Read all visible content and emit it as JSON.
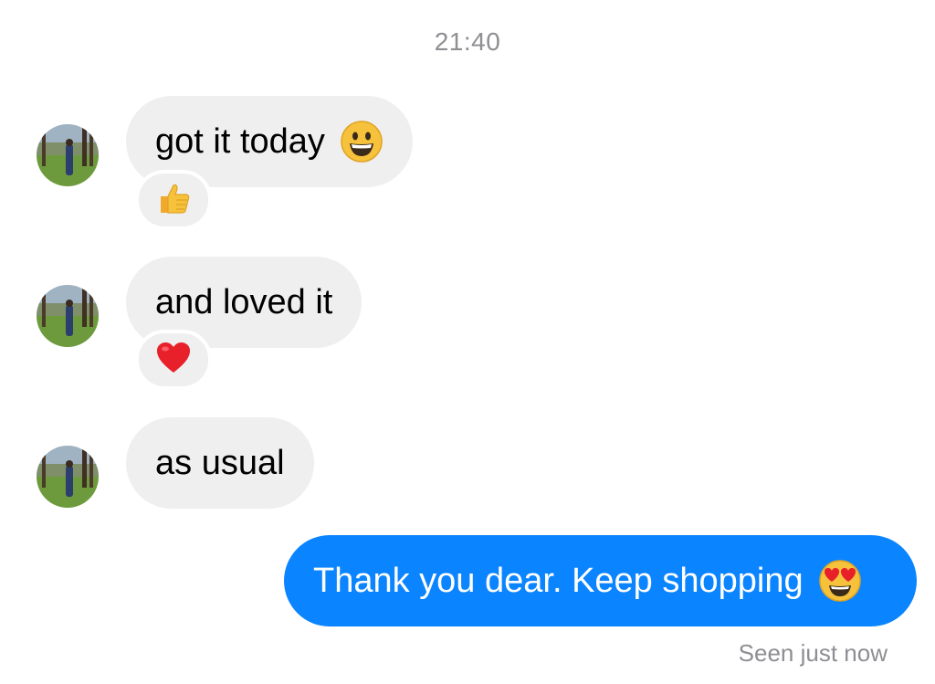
{
  "header": {
    "timestamp": "21:40"
  },
  "messages": [
    {
      "direction": "incoming",
      "text": "got it today",
      "emoji": "grinning-face-icon",
      "reaction": "thumbs-up-icon"
    },
    {
      "direction": "incoming",
      "text": "and loved it",
      "emoji": "",
      "reaction": "red-heart-icon"
    },
    {
      "direction": "incoming",
      "text": "as usual",
      "emoji": "",
      "reaction": ""
    },
    {
      "direction": "outgoing",
      "text": "Thank you dear. Keep shopping",
      "emoji": "heart-eyes-face-icon",
      "reaction": ""
    }
  ],
  "status": {
    "seen": "Seen just now"
  },
  "colors": {
    "incoming_bubble": "#efefef",
    "outgoing_bubble": "#0a84ff",
    "meta_text": "#8e8e93",
    "heart": "#e8202a"
  }
}
